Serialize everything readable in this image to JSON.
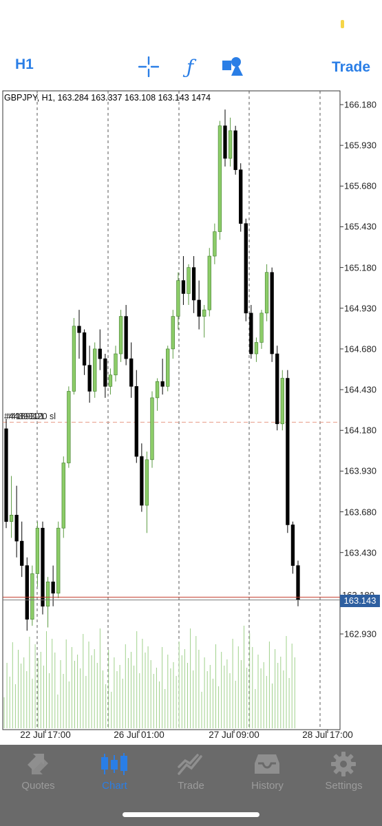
{
  "toolbar": {
    "timeframe": "H1",
    "trade_label": "Trade",
    "icons": [
      "crosshair-icon",
      "function-icon",
      "objects-icon"
    ],
    "accent_color": "#2a7ee6"
  },
  "chart": {
    "info": "GBPJPY, H1, 163.284 163.337 163.108 163.143 1474",
    "order_label_1": "#44893120 sl",
    "order_label_2": "#4189301",
    "current_price": "163.143",
    "current_price_obscured": "163.180",
    "bullish_color": "#8ccc68",
    "bearish_color": "#000000",
    "stop_line_color": "#e89a86",
    "price_line_color": "#c23a2a",
    "price_tag_color": "#2e5fa0"
  },
  "chart_data": {
    "type": "candlestick",
    "symbol": "GBPJPY",
    "timeframe": "H1",
    "y_ticks": [
      "166.180",
      "165.930",
      "165.680",
      "165.430",
      "165.180",
      "164.930",
      "164.680",
      "164.430",
      "164.180",
      "163.930",
      "163.680",
      "163.430",
      "162.930"
    ],
    "ylim": [
      162.83,
      166.32
    ],
    "x_ticks": [
      "22 Jul 17:00",
      "26 Jul 01:00",
      "27 Jul 09:00",
      "28 Jul 17:00"
    ],
    "stop_loss_level": 164.23,
    "bid_level": 163.143,
    "ohlc": [
      [
        164.19,
        164.25,
        163.58,
        163.62
      ],
      [
        163.62,
        163.9,
        163.52,
        163.66
      ],
      [
        163.66,
        163.84,
        163.4,
        163.5
      ],
      [
        163.5,
        163.62,
        163.28,
        163.35
      ],
      [
        163.35,
        163.4,
        162.95,
        163.02
      ],
      [
        163.02,
        163.35,
        162.98,
        163.3
      ],
      [
        163.3,
        163.62,
        163.22,
        163.58
      ],
      [
        163.58,
        163.62,
        163.05,
        163.1
      ],
      [
        163.1,
        163.28,
        162.97,
        163.25
      ],
      [
        163.25,
        163.35,
        163.1,
        163.18
      ],
      [
        163.18,
        163.62,
        163.15,
        163.58
      ],
      [
        163.58,
        164.02,
        163.52,
        163.98
      ],
      [
        163.98,
        164.45,
        163.95,
        164.42
      ],
      [
        164.42,
        164.87,
        164.4,
        164.82
      ],
      [
        164.82,
        164.92,
        164.62,
        164.78
      ],
      [
        164.78,
        164.8,
        164.52,
        164.58
      ],
      [
        164.58,
        164.7,
        164.35,
        164.42
      ],
      [
        164.42,
        164.72,
        164.38,
        164.68
      ],
      [
        164.68,
        164.8,
        164.55,
        164.62
      ],
      [
        164.62,
        164.65,
        164.38,
        164.45
      ],
      [
        164.45,
        164.56,
        164.4,
        164.52
      ],
      [
        164.52,
        164.7,
        164.48,
        164.65
      ],
      [
        164.65,
        164.92,
        164.6,
        164.88
      ],
      [
        164.88,
        164.95,
        164.58,
        164.62
      ],
      [
        164.62,
        164.72,
        164.38,
        164.45
      ],
      [
        164.45,
        164.55,
        163.98,
        164.02
      ],
      [
        164.02,
        164.1,
        163.68,
        163.72
      ],
      [
        163.72,
        164.05,
        163.55,
        164.0
      ],
      [
        164.0,
        164.42,
        163.95,
        164.38
      ],
      [
        164.38,
        164.5,
        164.3,
        164.48
      ],
      [
        164.48,
        164.62,
        164.4,
        164.45
      ],
      [
        164.45,
        164.7,
        164.42,
        164.68
      ],
      [
        164.68,
        164.92,
        164.62,
        164.88
      ],
      [
        164.88,
        165.15,
        164.8,
        165.1
      ],
      [
        165.1,
        165.25,
        164.95,
        165.02
      ],
      [
        165.02,
        165.2,
        164.95,
        165.18
      ],
      [
        165.18,
        165.25,
        164.9,
        164.98
      ],
      [
        164.98,
        165.1,
        164.8,
        164.88
      ],
      [
        164.88,
        164.95,
        164.75,
        164.92
      ],
      [
        164.92,
        165.3,
        164.88,
        165.25
      ],
      [
        165.25,
        165.45,
        165.2,
        165.4
      ],
      [
        165.4,
        166.08,
        165.35,
        166.05
      ],
      [
        166.05,
        166.15,
        165.8,
        165.85
      ],
      [
        165.85,
        166.1,
        165.8,
        166.02
      ],
      [
        166.02,
        166.05,
        165.75,
        165.78
      ],
      [
        165.78,
        165.82,
        165.4,
        165.45
      ],
      [
        165.45,
        165.48,
        164.85,
        164.9
      ],
      [
        164.9,
        164.95,
        164.62,
        164.65
      ],
      [
        164.65,
        164.75,
        164.6,
        164.72
      ],
      [
        164.72,
        164.92,
        164.68,
        164.9
      ],
      [
        164.9,
        165.2,
        164.85,
        165.15
      ],
      [
        165.15,
        165.18,
        164.6,
        164.65
      ],
      [
        164.65,
        164.7,
        164.18,
        164.22
      ],
      [
        164.22,
        164.55,
        164.18,
        164.5
      ],
      [
        164.5,
        164.55,
        163.55,
        163.6
      ],
      [
        163.6,
        163.62,
        163.3,
        163.35
      ],
      [
        163.35,
        163.38,
        163.1,
        163.14
      ]
    ]
  },
  "tabs": [
    {
      "label": "Quotes",
      "icon": "quotes-icon",
      "active": false
    },
    {
      "label": "Chart",
      "icon": "candlestick-icon",
      "active": true
    },
    {
      "label": "Trade",
      "icon": "trade-icon",
      "active": false
    },
    {
      "label": "History",
      "icon": "history-icon",
      "active": false
    },
    {
      "label": "Settings",
      "icon": "gear-icon",
      "active": false
    }
  ]
}
